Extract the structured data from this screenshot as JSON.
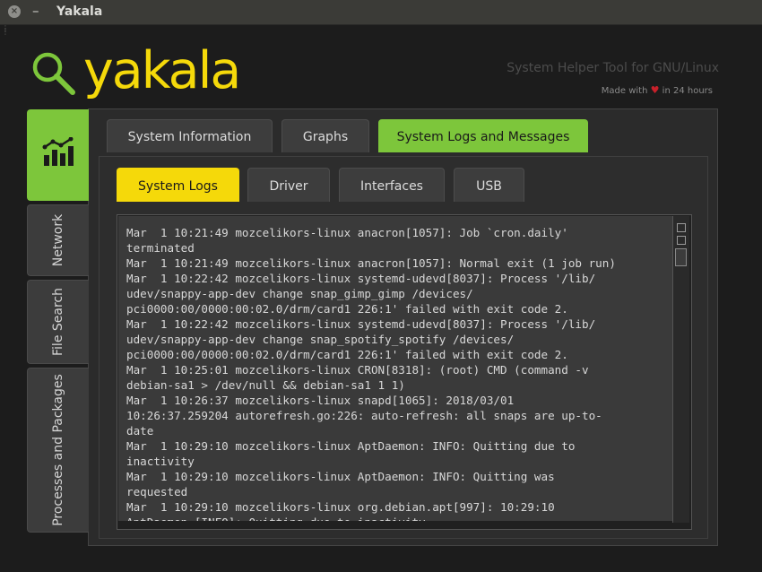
{
  "window": {
    "title": "Yakala",
    "close_glyph": "×",
    "minimize_glyph": "–"
  },
  "header": {
    "logo_text": "yakala",
    "subtitle": "System Helper Tool for GNU/Linux",
    "made_with_prefix": "Made with",
    "made_with_suffix": "in 24 hours",
    "heart_glyph": "♥",
    "brand_yellow": "#f5d90a",
    "brand_green": "#7dc63b"
  },
  "sidebar": {
    "items": [
      {
        "label": "",
        "icon": "bar-chart-icon"
      },
      {
        "label": "Network"
      },
      {
        "label": "File Search"
      },
      {
        "label": "Processes and Packages"
      }
    ]
  },
  "tabs": [
    {
      "label": "System Information"
    },
    {
      "label": "Graphs"
    },
    {
      "label": "System Logs and Messages"
    }
  ],
  "subtabs": [
    {
      "label": "System Logs"
    },
    {
      "label": "Driver"
    },
    {
      "label": "Interfaces"
    },
    {
      "label": "USB"
    }
  ],
  "log": {
    "lines": [
      "Mar  1 10:21:49 mozcelikors-linux anacron[1057]: Job `cron.daily'",
      "terminated",
      "Mar  1 10:21:49 mozcelikors-linux anacron[1057]: Normal exit (1 job run)",
      "Mar  1 10:22:42 mozcelikors-linux systemd-udevd[8037]: Process '/lib/",
      "udev/snappy-app-dev change snap_gimp_gimp /devices/",
      "pci0000:00/0000:00:02.0/drm/card1 226:1' failed with exit code 2.",
      "Mar  1 10:22:42 mozcelikors-linux systemd-udevd[8037]: Process '/lib/",
      "udev/snappy-app-dev change snap_spotify_spotify /devices/",
      "pci0000:00/0000:00:02.0/drm/card1 226:1' failed with exit code 2.",
      "Mar  1 10:25:01 mozcelikors-linux CRON[8318]: (root) CMD (command -v",
      "debian-sa1 > /dev/null && debian-sa1 1 1)",
      "Mar  1 10:26:37 mozcelikors-linux snapd[1065]: 2018/03/01",
      "10:26:37.259204 autorefresh.go:226: auto-refresh: all snaps are up-to-",
      "date",
      "Mar  1 10:29:10 mozcelikors-linux AptDaemon: INFO: Quitting due to",
      "inactivity",
      "Mar  1 10:29:10 mozcelikors-linux AptDaemon: INFO: Quitting was",
      "requested",
      "Mar  1 10:29:10 mozcelikors-linux org.debian.apt[997]: 10:29:10",
      "AptDaemon [INFO]: Quitting due to inactivity"
    ]
  }
}
